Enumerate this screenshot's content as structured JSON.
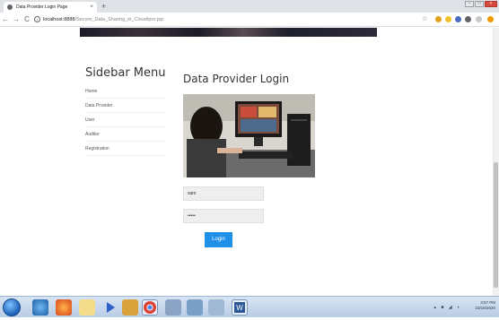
{
  "browser": {
    "tab_title": "Data Provider Login Page",
    "tab_close": "×",
    "new_tab": "+",
    "back": "←",
    "forward": "→",
    "reload": "C",
    "url_host": "localhost:8888",
    "url_path": "/Secure_Data_Sharing_in_Cloud/pro.jsp",
    "bookmark_star": "☆"
  },
  "sidebar": {
    "title": "Sidebar Menu",
    "items": [
      {
        "label": "Home"
      },
      {
        "label": "Data Provider"
      },
      {
        "label": "User"
      },
      {
        "label": "Auditor"
      },
      {
        "label": "Registration"
      }
    ]
  },
  "main": {
    "title": "Data Provider Login",
    "username_value": "sam",
    "password_value": "•••••",
    "login_label": "Login"
  },
  "taskbar": {
    "time": "3:57 PM",
    "date": "10/16/2020",
    "word_label": "W"
  },
  "colors": {
    "accent": "#1e90e8",
    "input_bg": "#eeeeee"
  }
}
